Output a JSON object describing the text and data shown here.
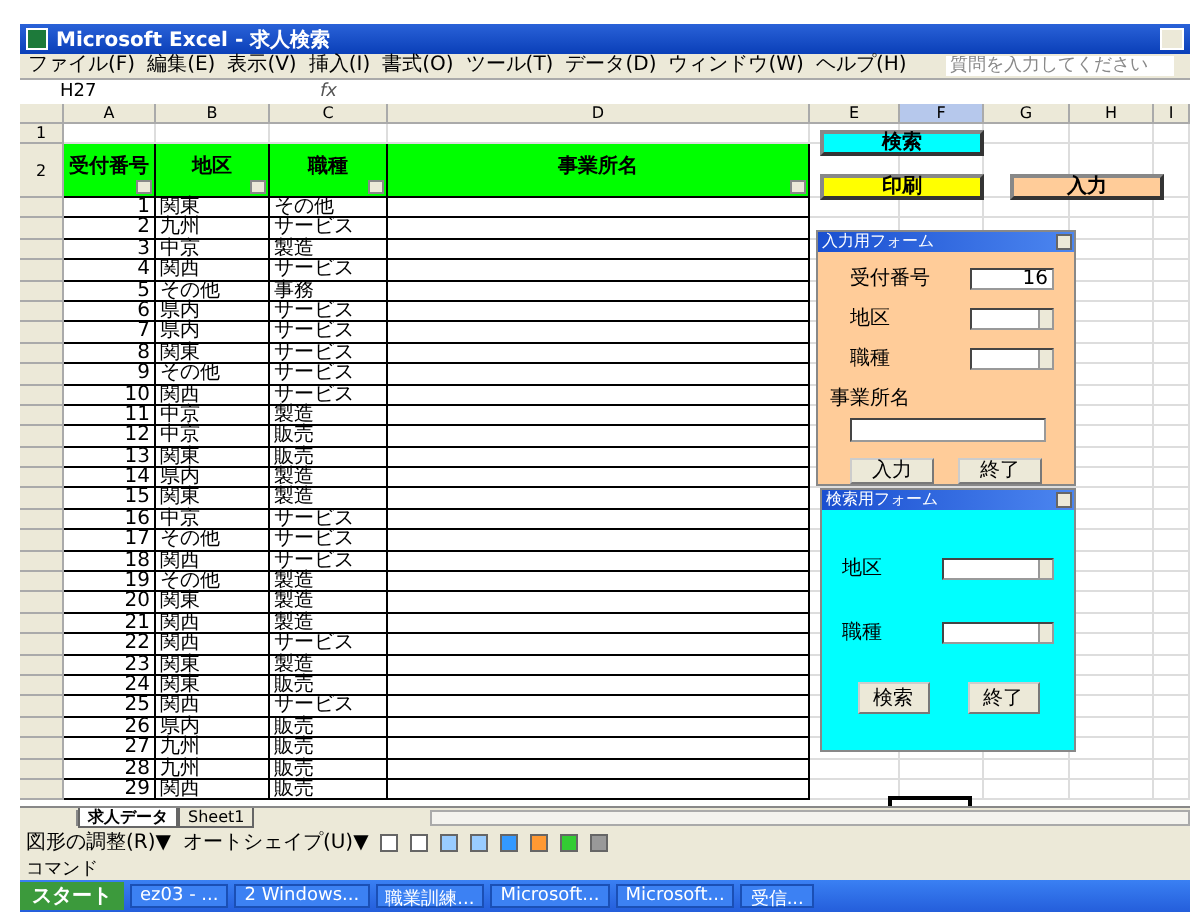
{
  "window": {
    "title": "Microsoft Excel - 求人検索"
  },
  "menu": [
    "ファイル(F)",
    "編集(E)",
    "表示(V)",
    "挿入(I)",
    "書式(O)",
    "ツール(T)",
    "データ(D)",
    "ウィンドウ(W)",
    "ヘルプ(H)"
  ],
  "help_box": {
    "placeholder": "質問を入力してください"
  },
  "name_box": {
    "value": "H27"
  },
  "formula_label": "fx",
  "columns": [
    {
      "label": "A",
      "selected": false
    },
    {
      "label": "B",
      "selected": false
    },
    {
      "label": "C",
      "selected": false
    },
    {
      "label": "D",
      "selected": false
    },
    {
      "label": "E",
      "selected": false
    },
    {
      "label": "F",
      "selected": true
    },
    {
      "label": "G",
      "selected": false
    },
    {
      "label": "H",
      "selected": false
    },
    {
      "label": "I",
      "selected": false
    }
  ],
  "top_rows": [
    "1",
    "2"
  ],
  "headers": [
    "受付番号",
    "地区",
    "職種",
    "事業所名"
  ],
  "rows": [
    {
      "no": "1",
      "area": "関東",
      "job": "その他"
    },
    {
      "no": "2",
      "area": "九州",
      "job": "サービス"
    },
    {
      "no": "3",
      "area": "中京",
      "job": "製造"
    },
    {
      "no": "4",
      "area": "関西",
      "job": "サービス"
    },
    {
      "no": "5",
      "area": "その他",
      "job": "事務"
    },
    {
      "no": "6",
      "area": "県内",
      "job": "サービス"
    },
    {
      "no": "7",
      "area": "県内",
      "job": "サービス"
    },
    {
      "no": "8",
      "area": "関東",
      "job": "サービス"
    },
    {
      "no": "9",
      "area": "その他",
      "job": "サービス"
    },
    {
      "no": "10",
      "area": "関西",
      "job": "サービス"
    },
    {
      "no": "11",
      "area": "中京",
      "job": "製造"
    },
    {
      "no": "12",
      "area": "中京",
      "job": "販売"
    },
    {
      "no": "13",
      "area": "関東",
      "job": "販売"
    },
    {
      "no": "14",
      "area": "県内",
      "job": "製造"
    },
    {
      "no": "15",
      "area": "関東",
      "job": "製造"
    },
    {
      "no": "16",
      "area": "中京",
      "job": "サービス"
    },
    {
      "no": "17",
      "area": "その他",
      "job": "サービス"
    },
    {
      "no": "18",
      "area": "関西",
      "job": "サービス"
    },
    {
      "no": "19",
      "area": "その他",
      "job": "製造"
    },
    {
      "no": "20",
      "area": "関東",
      "job": "製造"
    },
    {
      "no": "21",
      "area": "関西",
      "job": "製造"
    },
    {
      "no": "22",
      "area": "関西",
      "job": "サービス"
    },
    {
      "no": "23",
      "area": "関東",
      "job": "製造"
    },
    {
      "no": "24",
      "area": "関東",
      "job": "販売"
    },
    {
      "no": "25",
      "area": "関西",
      "job": "サービス"
    },
    {
      "no": "26",
      "area": "県内",
      "job": "販売"
    },
    {
      "no": "27",
      "area": "九州",
      "job": "販売"
    },
    {
      "no": "28",
      "area": "九州",
      "job": "販売"
    },
    {
      "no": "29",
      "area": "関西",
      "job": "販売"
    }
  ],
  "sheet_buttons": [
    {
      "label": "検索",
      "color": "#00ffff"
    },
    {
      "label": "印刷",
      "color": "#ffff00"
    },
    {
      "label": "入力",
      "color": "#ffcc99"
    }
  ],
  "input_form": {
    "title": "入力用フォーム",
    "fields": [
      {
        "kind": "text",
        "label": "受付番号",
        "value": "16"
      },
      {
        "kind": "select",
        "label": "地区"
      },
      {
        "kind": "select",
        "label": "職種"
      }
    ],
    "name_label": "事業所名",
    "buttons": [
      "入力",
      "終了"
    ]
  },
  "search_form": {
    "title": "検索用フォーム",
    "fields": [
      {
        "kind": "select",
        "label": "地区"
      },
      {
        "kind": "select",
        "label": "職種"
      }
    ],
    "buttons": [
      "検索",
      "終了"
    ]
  },
  "sheet_tabs": [
    {
      "label": "求人データ",
      "selected": true
    },
    {
      "label": "Sheet1",
      "selected": false
    }
  ],
  "drawing_toolbar": [
    "図形の調整(R)▼",
    "オートシェイプ(U)▼"
  ],
  "status_bar": "コマンド",
  "taskbar": {
    "start": "スタート",
    "items": [
      "ez03 - ...",
      "2 Windows...",
      "職業訓練...",
      "Microsoft...",
      "Microsoft...",
      "受信..."
    ]
  }
}
